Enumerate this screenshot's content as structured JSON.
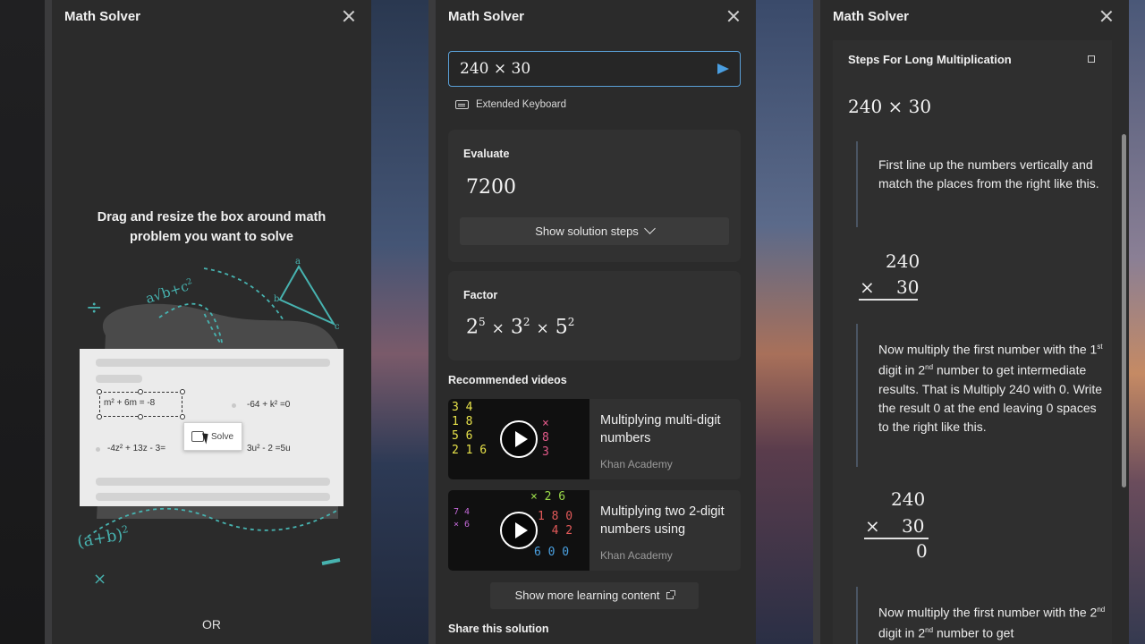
{
  "panels": {
    "left": {
      "title": "Math Solver",
      "instruction": "Drag and resize the box around math problem you want to solve",
      "or_label": "OR",
      "doodles": {
        "division": "÷",
        "sqrt": "a√b+c",
        "sqrt_power": "2",
        "binomial": "(a+b)",
        "binomial_power": "2",
        "times": "×",
        "triangle_a": "a",
        "triangle_b": "b",
        "triangle_c": "c"
      },
      "illustration": {
        "selected_equation": "m² + 6m = -8",
        "eq2": "-64 + k² =0",
        "eq3": "-4z² + 13z - 3=",
        "eq4": "3u² - 2  =5u",
        "solve_label": "Solve"
      }
    },
    "middle": {
      "title": "Math Solver",
      "input_value": "240 × 30",
      "extended_keyboard": "Extended Keyboard",
      "evaluate": {
        "label": "Evaluate",
        "value": "7200",
        "steps_button": "Show solution steps"
      },
      "factor": {
        "label": "Factor",
        "base1": "2",
        "exp1": "5",
        "base2": "3",
        "exp2": "2",
        "base3": "5",
        "exp3": "2",
        "op": "×"
      },
      "recommended_title": "Recommended videos",
      "videos": [
        {
          "title": "Multiplying multi-digit numbers",
          "source": "Khan Academy"
        },
        {
          "title": "Multiplying two 2-digit numbers using",
          "source": "Khan Academy"
        }
      ],
      "more_button": "Show more learning content",
      "share_title": "Share this solution"
    },
    "right": {
      "title": "Math Solver",
      "steps_heading": "Steps For Long Multiplication",
      "expression": "240 × 30",
      "step1": "First line up the numbers vertically and match the places from the right like this.",
      "calc1": {
        "top": "240",
        "op": "×",
        "bottom": "30"
      },
      "step2": {
        "a": "Now multiply the first number with the 1",
        "sup1": "st",
        "b": " digit in 2",
        "sup2": "nd",
        "c": " number to get intermediate results. That is Multiply 240 with 0. Write the result 0 at the end leaving 0 spaces to the right like this."
      },
      "calc2": {
        "top": "240",
        "op": "×",
        "bottom": "30",
        "result": "0"
      },
      "step3": {
        "a": "Now multiply the first number with the 2",
        "sup1": "nd",
        "b": " digit in 2",
        "sup2": "nd",
        "c": " number to get"
      }
    }
  },
  "colors": {
    "panel_bg": "#2b2b2b",
    "card_bg": "#313131",
    "accent_blue": "#5aa0d8",
    "doodle_teal": "#47b3b0"
  }
}
